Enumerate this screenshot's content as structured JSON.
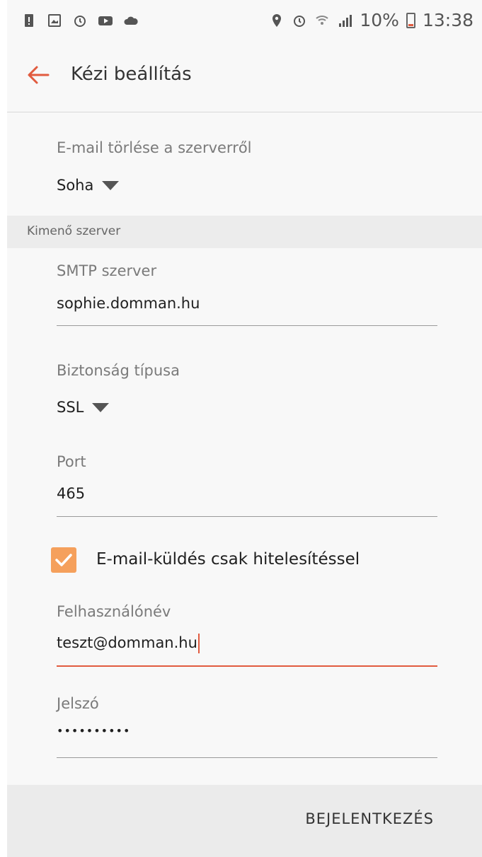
{
  "status_bar": {
    "battery_percent": "10%",
    "time": "13:38"
  },
  "app_bar": {
    "title": "Kézi beállítás"
  },
  "incoming": {
    "delete_label": "E-mail törlése a szerverről",
    "delete_value": "Soha"
  },
  "section": {
    "outgoing_header": "Kimenő szerver"
  },
  "outgoing": {
    "smtp_label": "SMTP szerver",
    "smtp_value": "sophie.domman.hu",
    "security_label": "Biztonság típusa",
    "security_value": "SSL",
    "port_label": "Port",
    "port_value": "465",
    "auth_checkbox_label": "E-mail-küldés csak hitelesítéssel",
    "auth_checked": true,
    "username_label": "Felhasználónév",
    "username_value": "teszt@domman.hu",
    "password_label": "Jelszó",
    "password_value": "••••••••••"
  },
  "bottom": {
    "login_label": "BEJELENTKEZÉS"
  },
  "colors": {
    "accent": "#e15b3f",
    "checkbox": "#f5a05c"
  }
}
